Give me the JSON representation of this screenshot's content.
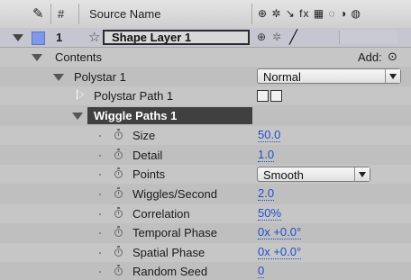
{
  "header": {
    "num_label": "#",
    "source_name_label": "Source Name",
    "switch_icons": "⊕ ✲ ↘ fx ▦ ◌ ◑ ◍"
  },
  "layer": {
    "number": "1",
    "name": "Shape Layer 1",
    "label_color": "#7f98ea"
  },
  "contents": {
    "label": "Contents",
    "add_label": "Add:"
  },
  "polystar": {
    "label": "Polystar 1",
    "blend_mode": "Normal"
  },
  "polystar_path": {
    "label": "Polystar Path 1"
  },
  "wiggle": {
    "label": "Wiggle Paths 1",
    "properties": [
      {
        "name": "Size",
        "value": "50.0"
      },
      {
        "name": "Detail",
        "value": "1.0"
      },
      {
        "name": "Points",
        "value": "Smooth"
      },
      {
        "name": "Wiggles/Second",
        "value": "2.0"
      },
      {
        "name": "Correlation",
        "value": "50%"
      },
      {
        "name": "Temporal Phase",
        "value": "0x +0.0°"
      },
      {
        "name": "Spatial Phase",
        "value": "0x +0.0°"
      },
      {
        "name": "Random Seed",
        "value": "0"
      }
    ]
  }
}
